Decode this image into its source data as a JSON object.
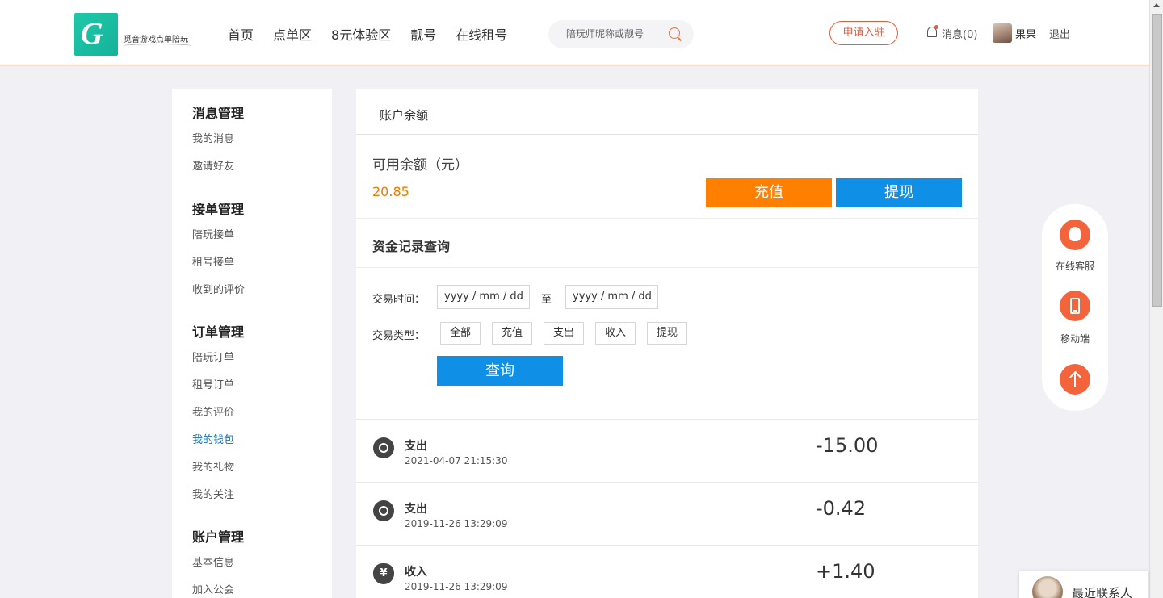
{
  "header": {
    "logo_text": "觅音游戏点单陪玩",
    "nav": [
      "首页",
      "点单区",
      "8元体验区",
      "靓号",
      "在线租号"
    ],
    "search_placeholder": "陪玩师昵称或靓号",
    "apply_label": "申请入驻",
    "messages_label": "消息(0)",
    "user_name": "果果",
    "logout_label": "退出"
  },
  "sidebar": {
    "groups": [
      {
        "title": "消息管理",
        "items": [
          "我的消息",
          "邀请好友"
        ]
      },
      {
        "title": "接单管理",
        "items": [
          "陪玩接单",
          "租号接单",
          "收到的评价"
        ]
      },
      {
        "title": "订单管理",
        "items": [
          "陪玩订单",
          "租号订单",
          "我的评价",
          "我的钱包",
          "我的礼物",
          "我的关注"
        ]
      },
      {
        "title": "账户管理",
        "items": [
          "基本信息",
          "加入公会"
        ]
      }
    ],
    "active_item": "我的钱包",
    "active_color": "#1a6fb8"
  },
  "main": {
    "title": "账户余额",
    "balance_label": "可用余额（元）",
    "balance_value": "20.85",
    "recharge_label": "充值",
    "withdraw_label": "提现",
    "query_title": "资金记录查询",
    "time_label": "交易时间：",
    "date_placeholder": "yyyy / mm / dd",
    "to_label": "至",
    "type_label": "交易类型：",
    "types": [
      "全部",
      "充值",
      "支出",
      "收入",
      "提现"
    ],
    "query_label": "查询",
    "records": [
      {
        "type": "支出",
        "time": "2021-04-07 21:15:30",
        "amount": "-15.00",
        "kind": "out"
      },
      {
        "type": "支出",
        "time": "2019-11-26 13:29:09",
        "amount": "-0.42",
        "kind": "out"
      },
      {
        "type": "收入",
        "time": "2019-11-26 13:29:09",
        "amount": "+1.40",
        "kind": "in"
      }
    ],
    "yen_symbol": "¥"
  },
  "float": {
    "service_label": "在线客服",
    "mobile_label": "移动端"
  },
  "recent": {
    "label": "最近联系人"
  },
  "colors": {
    "orange": "#ff7f00",
    "blue": "#0f8fe6",
    "accent_red": "#f05a3c"
  }
}
